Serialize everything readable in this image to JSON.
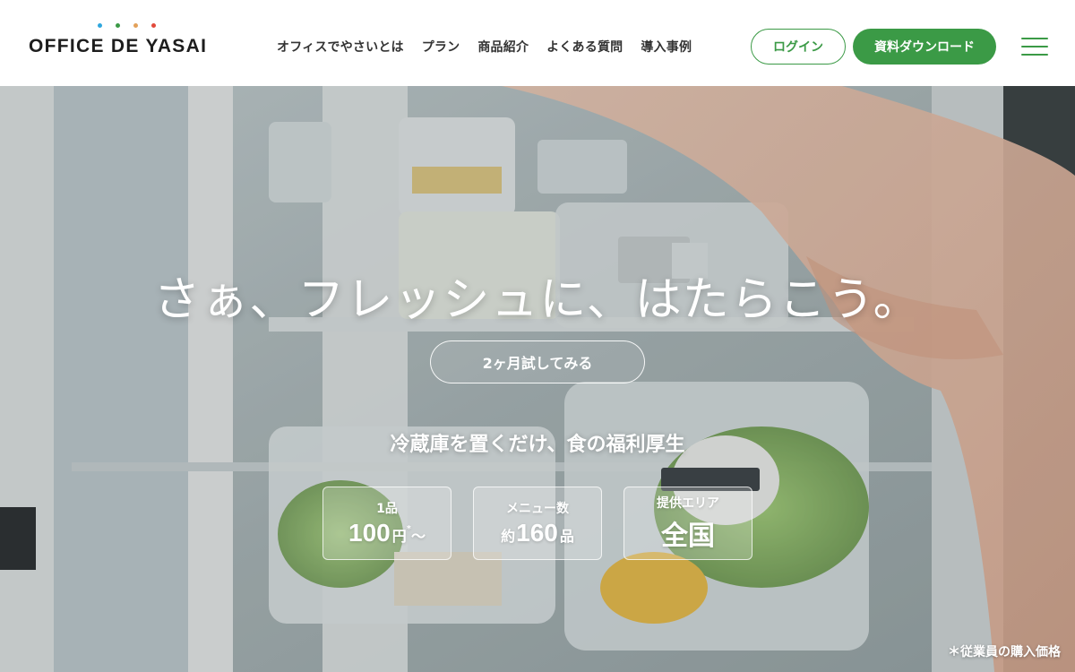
{
  "brand": {
    "logo_text": "OFFICE DE YASAI",
    "dot_colors": [
      "#2fa7de",
      "#3b9a46",
      "#e3a15a",
      "#e24a3b"
    ],
    "accent_color": "#3b9a46"
  },
  "nav": {
    "links": [
      "オフィスでやさいとは",
      "プラン",
      "商品紹介",
      "よくある質問",
      "導入事例"
    ]
  },
  "header_actions": {
    "login_label": "ログイン",
    "download_label": "資料ダウンロード",
    "menu_icon": "hamburger-icon"
  },
  "hero": {
    "headline": "さぁ、フレッシュに、はたらこう。",
    "trial_label": "2ヶ月試してみる",
    "subhead": "冷蔵庫を置くだけ、食の福利厚生",
    "stats": [
      {
        "label": "1品",
        "number": "100",
        "unit": "円",
        "mark": "*",
        "tail": "〜"
      },
      {
        "label": "メニュー数",
        "prefix": "約",
        "number": "160",
        "unit": "品"
      },
      {
        "label": "提供エリア",
        "value": "全国"
      }
    ],
    "footnote": "＊従業員の購入価格"
  }
}
